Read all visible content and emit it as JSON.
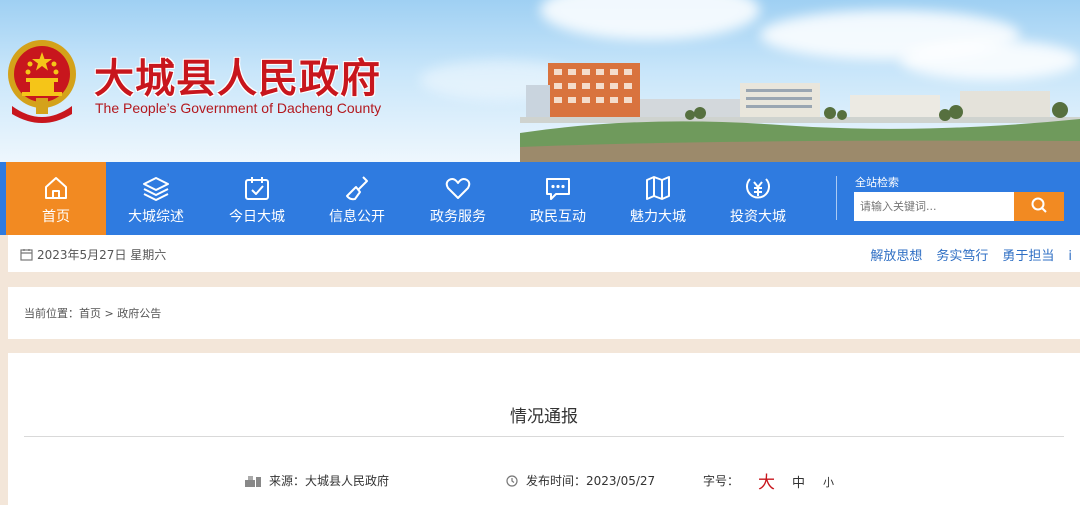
{
  "banner": {
    "title": "大城县人民政府",
    "subtitle": "The People’s Government of Dacheng County"
  },
  "nav": {
    "items": [
      {
        "label": "首页",
        "icon": "home-icon",
        "active": true
      },
      {
        "label": "大城综述",
        "icon": "layers-icon"
      },
      {
        "label": "今日大城",
        "icon": "calendar-check-icon"
      },
      {
        "label": "信息公开",
        "icon": "broom-icon"
      },
      {
        "label": "政务服务",
        "icon": "heart-icon"
      },
      {
        "label": "政民互动",
        "icon": "chat-icon"
      },
      {
        "label": "魅力大城",
        "icon": "map-icon"
      },
      {
        "label": "投资大城",
        "icon": "yuan-icon"
      }
    ],
    "search": {
      "label": "全站检索",
      "placeholder": "请输入关键词..."
    }
  },
  "infobar": {
    "date": "2023年5月27日 星期六",
    "slogans": [
      "解放思想",
      "务实笃行",
      "勇于担当",
      "i"
    ]
  },
  "breadcrumb": {
    "prefix": "当前位置：",
    "home": "首页",
    "separator": " > ",
    "current": "政府公告"
  },
  "article": {
    "title": "情况通报",
    "source_label": "来源：",
    "source": "大城县人民政府",
    "published_label": "发布时间：",
    "published": "2023/05/27",
    "font_size_label": "字号：",
    "font_size_options": [
      "大",
      "中",
      "小"
    ]
  },
  "colors": {
    "nav_blue": "#2f7be0",
    "accent_orange": "#f28a22",
    "title_red": "#c8161d",
    "link_blue": "#2f6fc4"
  }
}
